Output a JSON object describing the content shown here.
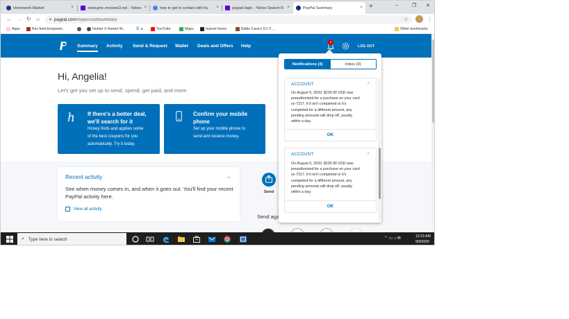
{
  "browser": {
    "tabs": [
      {
        "title": "Homework Market",
        "favicon_color": "#1f3a7a"
      },
      {
        "title": "www.gmc.mrooms3.net - Yahoo",
        "favicon_color": "#5f01d1"
      },
      {
        "title": "how to get in contact with hu",
        "favicon_color": "#4285f4"
      },
      {
        "title": "paypal login - Yahoo Search R",
        "favicon_color": "#5f01d1"
      },
      {
        "title": "PayPal Summary",
        "favicon_color": "#003087"
      }
    ],
    "active_tab": 4,
    "new_tab": "+",
    "close_glyph": "×",
    "window_controls": {
      "minimize": "–",
      "maximize": "❐",
      "close": "✕"
    },
    "url_host": "paypal.com",
    "url_path": "/myaccount/summary",
    "bookmarks": [
      {
        "label": "Apps",
        "color": "#e0533d"
      },
      {
        "label": "Rss feed Empower...",
        "color": "#b3261e"
      },
      {
        "label": "",
        "color": "#555555"
      },
      {
        "label": "Hunter X Hunter M...",
        "color": "#444444"
      },
      {
        "label": "a",
        "color": "#4285f4"
      },
      {
        "label": "YouTube",
        "color": "#ff0000"
      },
      {
        "label": "Maps",
        "color": "#34a853"
      },
      {
        "label": "marvel heros",
        "color": "#222222"
      },
      {
        "label": "Eddie Case's D.I.Y....",
        "color": "#8a4b2e"
      }
    ],
    "other_bookmarks": "Other bookmarks"
  },
  "paypal": {
    "brand_color": "#0070ba",
    "nav": [
      "Summary",
      "Activity",
      "Send & Request",
      "Wallet",
      "Deals and Offers",
      "Help"
    ],
    "active_nav": 0,
    "notification_count": "4",
    "logout": "LOG OUT",
    "greeting": "Hi, Angelia!",
    "subgreeting": "Let's get you set up to send, spend, get paid, and more.",
    "promos": [
      {
        "title_lines": [
          "If there's a better deal,",
          "we'll search for it"
        ],
        "body_lines": [
          "Honey finds and applies some",
          "of the best coupons for you",
          "automatically. Try it today."
        ]
      },
      {
        "title_lines": [
          "Confirm your mobile",
          "phone"
        ],
        "body_lines": [
          "Set up your mobile phone to",
          "send and receive money."
        ]
      }
    ],
    "recent_activity": {
      "title": "Recent activity",
      "arrow": "→",
      "body": "See when money comes in, and when it goes out. You'll find your recent PayPal activity here.",
      "link": "View all activity"
    },
    "send_label": "Send",
    "send_again": "Send again",
    "notifications": {
      "tabs": [
        {
          "label": "Notifications (4)",
          "active": true
        },
        {
          "label": "Inbox (0)",
          "active": false
        }
      ],
      "cards": [
        {
          "header": "ACCOUNT",
          "close": "×",
          "body_lines": [
            "On August 6, 2020, $230.90 USD was",
            "preauthorized for a purchase on your card",
            "xx-7317. If it isn't completed or it's",
            "completed for a different amount, any",
            "pending amounts will drop off, usually",
            "within a day."
          ],
          "ok": "OK"
        },
        {
          "header": "ACCOUNT",
          "close": "×",
          "body_lines": [
            "On August 6, 2020, $230.90 USD was",
            "preauthorized for a purchase on your card",
            "xx-7317. If it isn't completed or it's",
            "completed for a different amount, any",
            "pending amounts will drop off, usually",
            "within a day."
          ],
          "ok": "OK"
        }
      ]
    }
  },
  "taskbar": {
    "search_placeholder": "Type here to search",
    "clock_time": "12:15 AM",
    "clock_date": "8/9/2020",
    "tray": "⌃ ▭ ♪ ✉"
  }
}
